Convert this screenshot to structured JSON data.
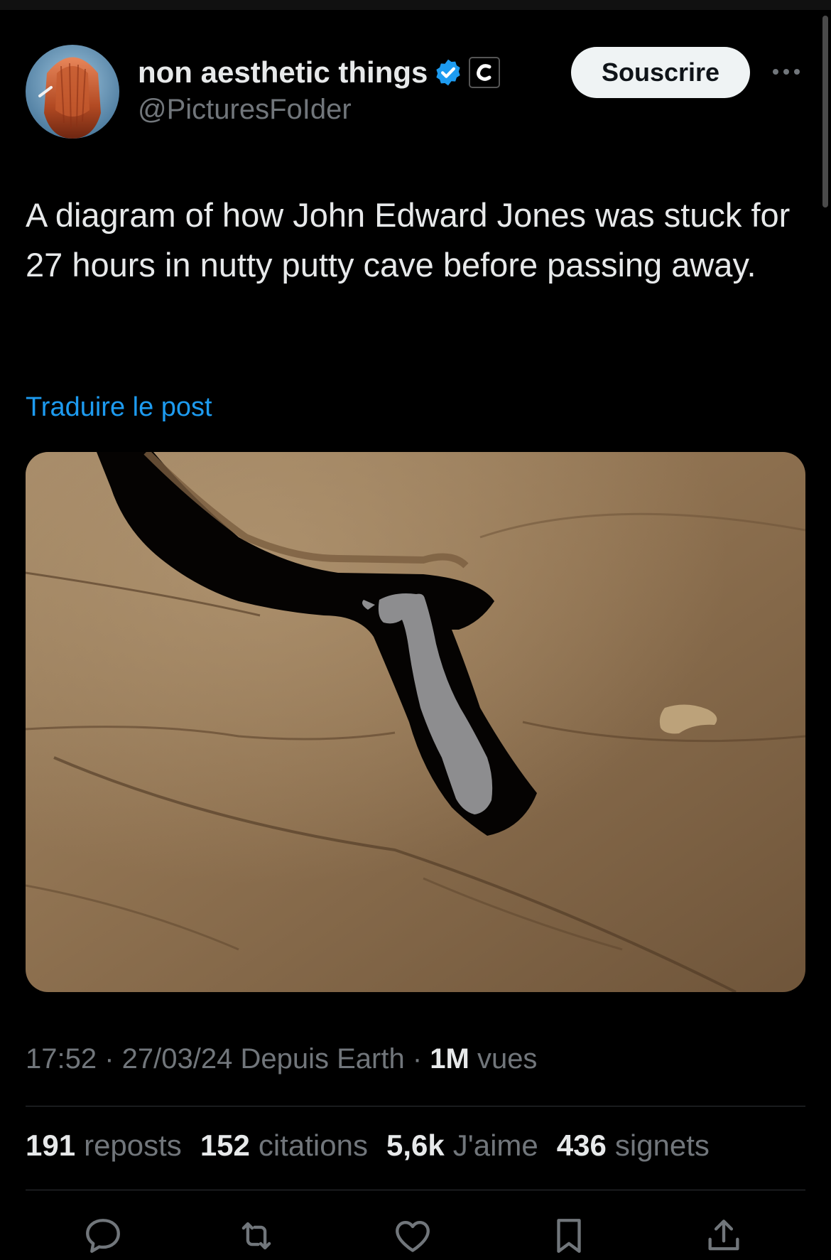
{
  "author": {
    "name": "non aesthetic things",
    "handle": "@PicturesFoIder",
    "verified": true,
    "affiliate_badge_icon": "c-affiliate-icon",
    "avatar_icon": "avatar-red-hair"
  },
  "header": {
    "subscribe_label": "Souscrire",
    "more_icon": "more-horizontal-icon"
  },
  "post": {
    "text": "A diagram of how John Edward Jones was stuck for 27 hours in nutty putty cave before passing away.",
    "translate_label": "Traduire le post",
    "media_description_icon": "cave-diagram-image"
  },
  "meta": {
    "time": "17:52",
    "sep1": " · ",
    "date": "27/03/24",
    "source": " Depuis Earth",
    "sep2": " · ",
    "views_count": "1M",
    "views_label": " vues"
  },
  "stats": [
    {
      "count": "191",
      "label": "reposts"
    },
    {
      "count": "152",
      "label": "citations"
    },
    {
      "count": "5,6k",
      "label": "J'aime"
    },
    {
      "count": "436",
      "label": "signets"
    }
  ],
  "actions": [
    "reply-icon",
    "repost-icon",
    "like-icon",
    "bookmark-icon",
    "share-icon"
  ],
  "colors": {
    "background": "#000000",
    "text": "#e7e9ea",
    "secondary": "#71767b",
    "link": "#1d9bf0",
    "verified": "#1d9bf0",
    "button_bg": "#eff3f4"
  }
}
